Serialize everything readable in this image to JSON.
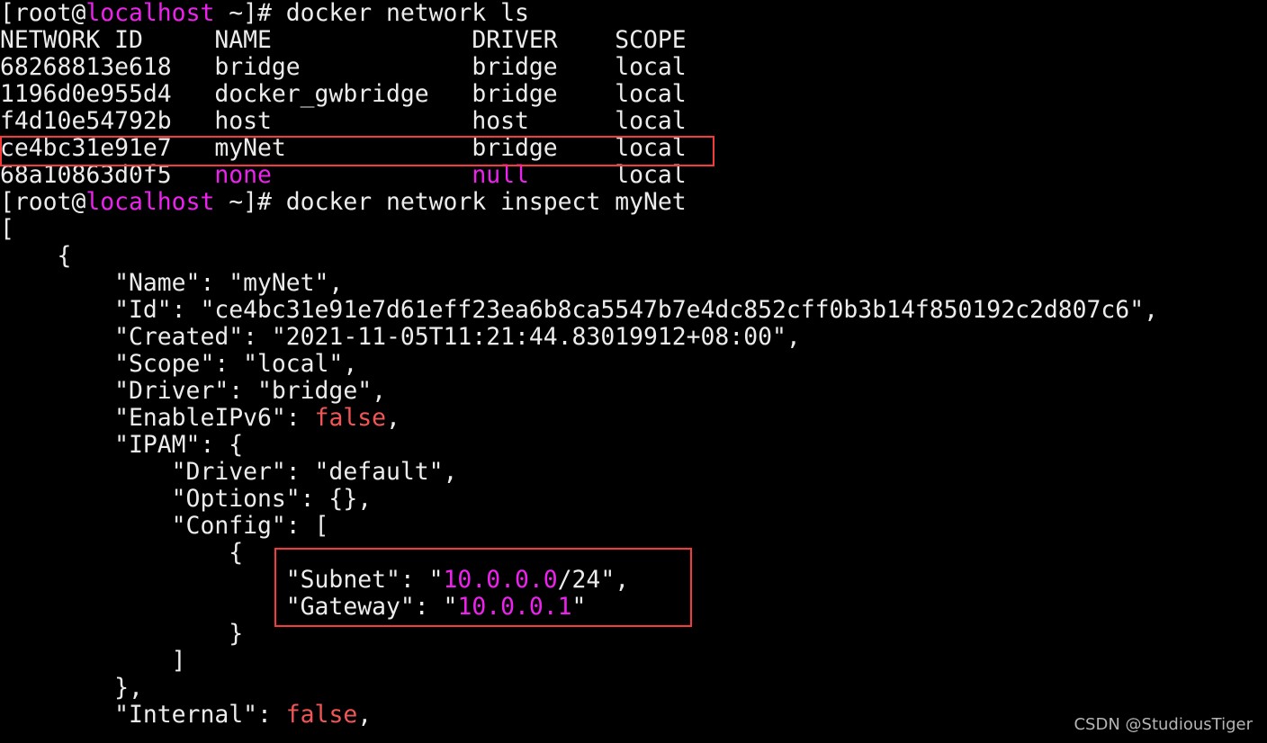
{
  "colors": {
    "text": "#ececec",
    "magenta": "#ee22ee",
    "red": "#f25555",
    "highlight": "#f43a3a",
    "background": "#000000"
  },
  "terminal": {
    "lines": [
      [
        {
          "t": "[root@",
          "c": "w"
        },
        {
          "t": "localhost",
          "c": "m"
        },
        {
          "t": " ~]# docker network ls",
          "c": "w"
        }
      ],
      [
        {
          "t": "NETWORK ID     NAME              DRIVER    SCOPE",
          "c": "w"
        }
      ],
      [
        {
          "t": "68268813e618   bridge            bridge    local",
          "c": "w"
        }
      ],
      [
        {
          "t": "1196d0e955d4   docker_gwbridge   bridge    local",
          "c": "w"
        }
      ],
      [
        {
          "t": "f4d10e54792b   host              host      local",
          "c": "w"
        }
      ],
      [
        {
          "t": "ce4bc31e91e7   myNet             bridge    local",
          "c": "w"
        }
      ],
      [
        {
          "t": "68a10863d0f5   ",
          "c": "w"
        },
        {
          "t": "none",
          "c": "m"
        },
        {
          "t": "              ",
          "c": "w"
        },
        {
          "t": "null",
          "c": "m"
        },
        {
          "t": "      local",
          "c": "w"
        }
      ],
      [
        {
          "t": "[root@",
          "c": "w"
        },
        {
          "t": "localhost",
          "c": "m"
        },
        {
          "t": " ~]# docker network inspect myNet",
          "c": "w"
        }
      ],
      [
        {
          "t": "[",
          "c": "w"
        }
      ],
      [
        {
          "t": "    {",
          "c": "w"
        }
      ],
      [
        {
          "t": "        \"Name\": \"myNet\",",
          "c": "w"
        }
      ],
      [
        {
          "t": "        \"Id\": \"ce4bc31e91e7d61eff23ea6b8ca5547b7e4dc852cff0b3b14f850192c2d807c6\",",
          "c": "w"
        }
      ],
      [
        {
          "t": "        \"Created\": \"2021-11-05T11:21:44.83019912+08:00\",",
          "c": "w"
        }
      ],
      [
        {
          "t": "        \"Scope\": \"local\",",
          "c": "w"
        }
      ],
      [
        {
          "t": "        \"Driver\": \"bridge\",",
          "c": "w"
        }
      ],
      [
        {
          "t": "        \"EnableIPv6\": ",
          "c": "w"
        },
        {
          "t": "false",
          "c": "r"
        },
        {
          "t": ",",
          "c": "w"
        }
      ],
      [
        {
          "t": "        \"IPAM\": {",
          "c": "w"
        }
      ],
      [
        {
          "t": "            \"Driver\": \"default\",",
          "c": "w"
        }
      ],
      [
        {
          "t": "            \"Options\": {},",
          "c": "w"
        }
      ],
      [
        {
          "t": "            \"Config\": [",
          "c": "w"
        }
      ],
      [
        {
          "t": "                {",
          "c": "w"
        }
      ],
      [
        {
          "t": "                    \"Subnet\": \"",
          "c": "w"
        },
        {
          "t": "10.0.0.0",
          "c": "m"
        },
        {
          "t": "/24\",",
          "c": "w"
        }
      ],
      [
        {
          "t": "                    \"Gateway\": \"",
          "c": "w"
        },
        {
          "t": "10.0.0.1",
          "c": "m"
        },
        {
          "t": "\"",
          "c": "w"
        }
      ],
      [
        {
          "t": "                }",
          "c": "w"
        }
      ],
      [
        {
          "t": "            ]",
          "c": "w"
        }
      ],
      [
        {
          "t": "        },",
          "c": "w"
        }
      ],
      [
        {
          "t": "        \"Internal\": ",
          "c": "w"
        },
        {
          "t": "false",
          "c": "r"
        },
        {
          "t": ",",
          "c": "w"
        }
      ]
    ]
  },
  "watermark": "CSDN @StudiousTiger"
}
